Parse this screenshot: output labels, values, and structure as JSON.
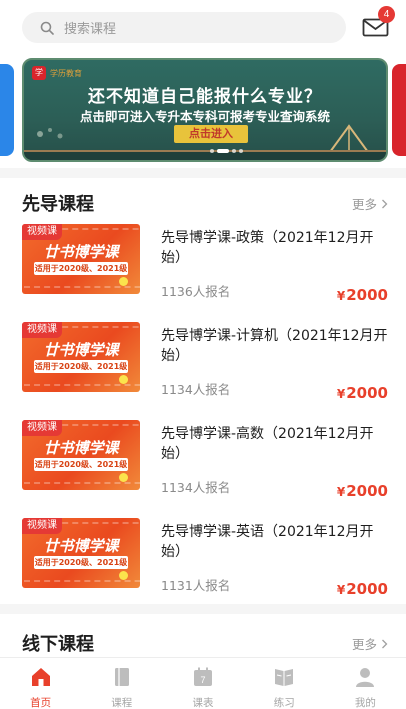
{
  "search": {
    "placeholder": "搜索课程"
  },
  "notifications": {
    "badge_count": "4"
  },
  "banner": {
    "logo_text": "学历教育",
    "headline": "还不知道自己能报什么专业？",
    "subline": "点击即可进入专升本专科可报考专业查询系统",
    "cta_label": "点击进入"
  },
  "section_leading": {
    "title": "先导课程",
    "more_label": "更多",
    "courses": [
      {
        "tag": "视频课",
        "thumb_title": "廿书博学课",
        "thumb_sub": "适用于2020级、2021级",
        "title": "先导博学课-政策（2021年12月开始）",
        "enrolled": "1136人报名",
        "price": "2000"
      },
      {
        "tag": "视频课",
        "thumb_title": "廿书博学课",
        "thumb_sub": "适用于2020级、2021级",
        "title": "先导博学课-计算机（2021年12月开始）",
        "enrolled": "1134人报名",
        "price": "2000"
      },
      {
        "tag": "视频课",
        "thumb_title": "廿书博学课",
        "thumb_sub": "适用于2020级、2021级",
        "title": "先导博学课-高数（2021年12月开始）",
        "enrolled": "1134人报名",
        "price": "2000"
      },
      {
        "tag": "视频课",
        "thumb_title": "廿书博学课",
        "thumb_sub": "适用于2020级、2021级",
        "title": "先导博学课-英语（2021年12月开始）",
        "enrolled": "1131人报名",
        "price": "2000"
      }
    ]
  },
  "section_offline": {
    "title": "线下课程",
    "more_label": "更多"
  },
  "currency_symbol": "¥",
  "bottom_nav": [
    {
      "label": "首页",
      "icon": "home-icon",
      "active": true
    },
    {
      "label": "课程",
      "icon": "book-icon",
      "active": false
    },
    {
      "label": "课表",
      "icon": "calendar-icon",
      "active": false
    },
    {
      "label": "练习",
      "icon": "exercise-book-icon",
      "active": false
    },
    {
      "label": "我的",
      "icon": "user-icon",
      "active": false
    }
  ],
  "colors": {
    "accent": "#e8402b",
    "price": "#e8402b",
    "badge": "#e53935",
    "banner_board": "#2f6b62",
    "thumb_orange": "#f26b2c"
  }
}
